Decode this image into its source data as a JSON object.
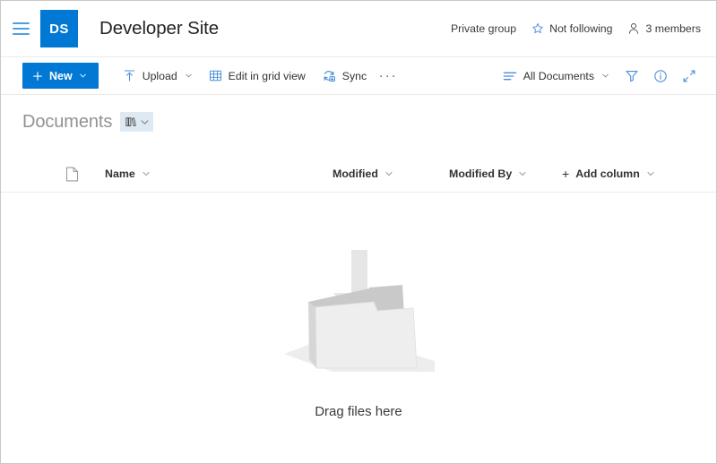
{
  "colors": {
    "brand_blue": "#0078d4",
    "hamburger_blue": "#4c9fe4",
    "icon_blue": "#4b8ddb",
    "title_gray": "#929292",
    "text_dark": "#323130",
    "divider": "#eaeaea",
    "view_pill_bg": "#dfe9f3",
    "folder_light": "#e8e8e8",
    "folder_mid": "#c8c8c8",
    "folder_shadow": "#ededed"
  },
  "header": {
    "menu_icon": "hamburger-icon",
    "logo_initials": "DS",
    "site_title": "Developer Site",
    "privacy_label": "Private group",
    "follow_icon": "star-outline-icon",
    "follow_label": "Not following",
    "members_icon": "person-icon",
    "members_label": "3 members"
  },
  "command_bar": {
    "new_label": "New",
    "new_icon": "plus-icon",
    "new_chevron": "chevron-down-icon",
    "upload_label": "Upload",
    "upload_icon": "upload-arrow-icon",
    "upload_chevron": "chevron-down-icon",
    "grid_label": "Edit in grid view",
    "grid_icon": "grid-table-icon",
    "sync_label": "Sync",
    "sync_icon": "sync-icon",
    "overflow_label": "···",
    "view_label": "All Documents",
    "view_icon": "view-list-icon",
    "view_chevron": "chevron-down-icon",
    "filter_icon": "filter-funnel-icon",
    "info_icon": "info-circle-icon",
    "expand_icon": "expand-diagonal-icon"
  },
  "library": {
    "title": "Documents",
    "view_pill_icon": "library-books-icon",
    "view_pill_chevron": "chevron-down-icon"
  },
  "columns": [
    {
      "key": "fileicon",
      "label": "",
      "icon": "file-page-icon",
      "sortable": false
    },
    {
      "key": "name",
      "label": "Name",
      "chevron": "chevron-down-icon",
      "sortable": true
    },
    {
      "key": "modified",
      "label": "Modified",
      "chevron": "chevron-down-icon",
      "sortable": true
    },
    {
      "key": "modifiedby",
      "label": "Modified By",
      "chevron": "chevron-down-icon",
      "sortable": true
    },
    {
      "key": "addcolumn",
      "label": "Add column",
      "prefix": "+",
      "chevron": "chevron-down-icon",
      "sortable": true
    }
  ],
  "empty_state": {
    "illustration": "drag-files-folder-illustration",
    "caption": "Drag files here"
  }
}
